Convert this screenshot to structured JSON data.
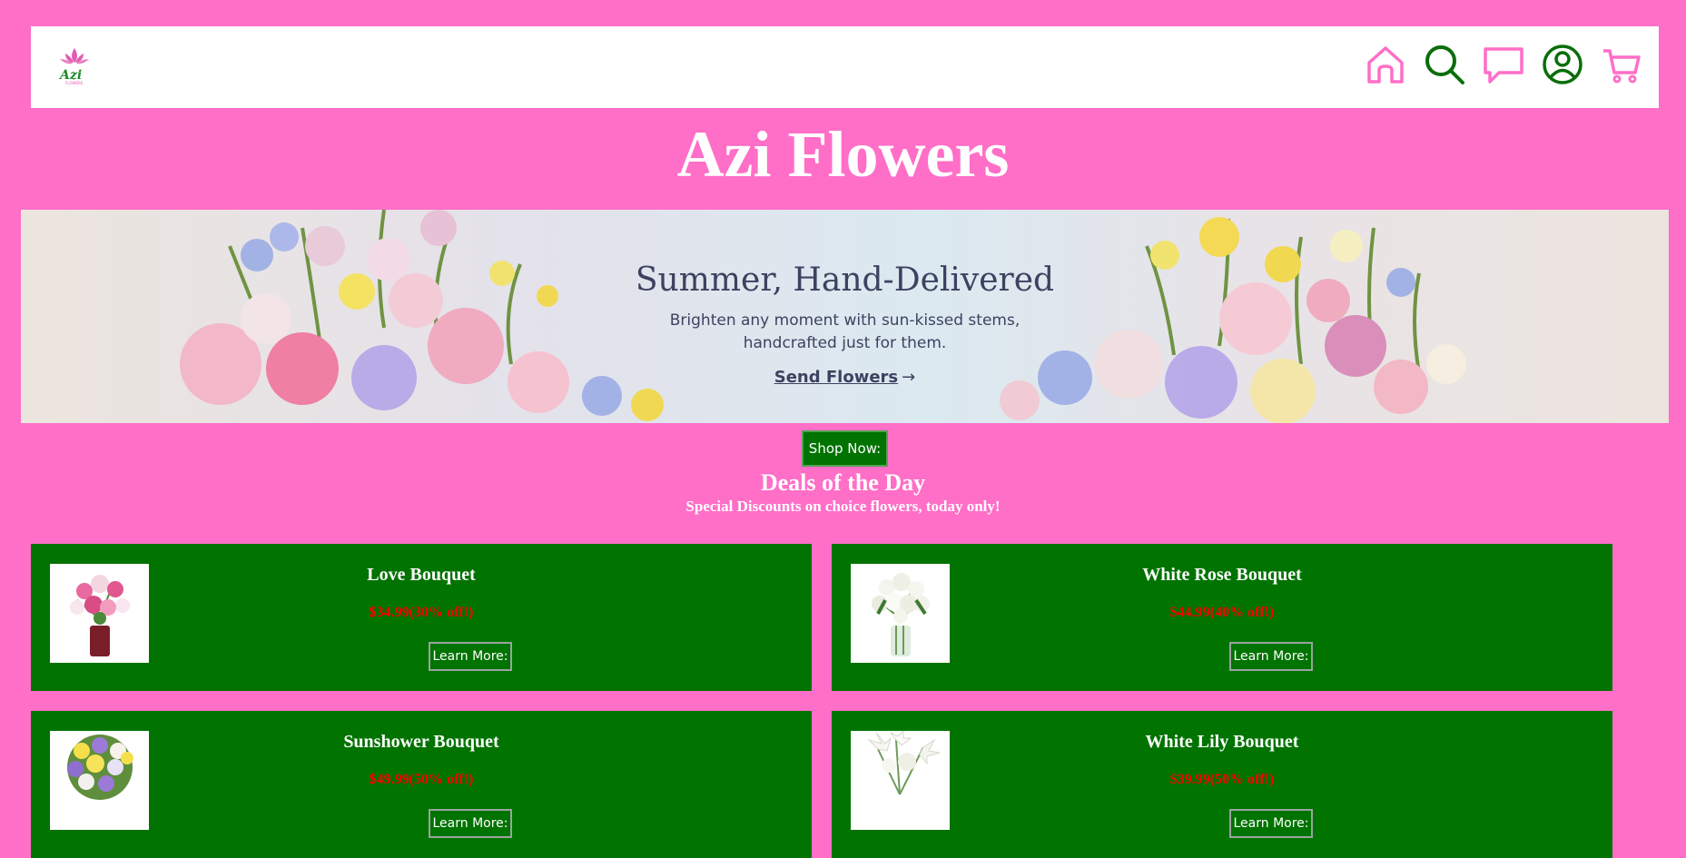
{
  "header": {
    "logo_text": "Azi",
    "nav_icons": [
      "home-icon",
      "search-icon",
      "chat-icon",
      "account-icon",
      "cart-icon"
    ],
    "pink_color": "#ff6ec7",
    "green_color": "#0a6e0a"
  },
  "site": {
    "title": "Azi Flowers"
  },
  "hero": {
    "heading": "Summer, Hand-Delivered",
    "subtext": "Brighten any moment with sun-kissed stems, handcrafted just for them.",
    "link_label": "Send Flowers",
    "arrow": "→"
  },
  "shop_button": "Shop Now:",
  "deals": {
    "title": "Deals of the Day",
    "subtitle": "Special Discounts on choice flowers, today only!"
  },
  "products": [
    {
      "name": "Love Bouquet",
      "price": "$34.99(30% off!)",
      "button": "Learn More:"
    },
    {
      "name": "White Rose Bouquet",
      "price": "$44.99(40% off!)",
      "button": "Learn More:"
    },
    {
      "name": "Sunshower Bouquet",
      "price": "$49.99(50% off!)",
      "button": "Learn More:"
    },
    {
      "name": "White Lily Bouquet",
      "price": "$39.99(50% off!)",
      "button": "Learn More:"
    }
  ],
  "colors": {
    "page_background": "#ff6ec7",
    "card_background": "#007300",
    "price_red": "#ff0000",
    "hero_text": "#3d4260"
  }
}
